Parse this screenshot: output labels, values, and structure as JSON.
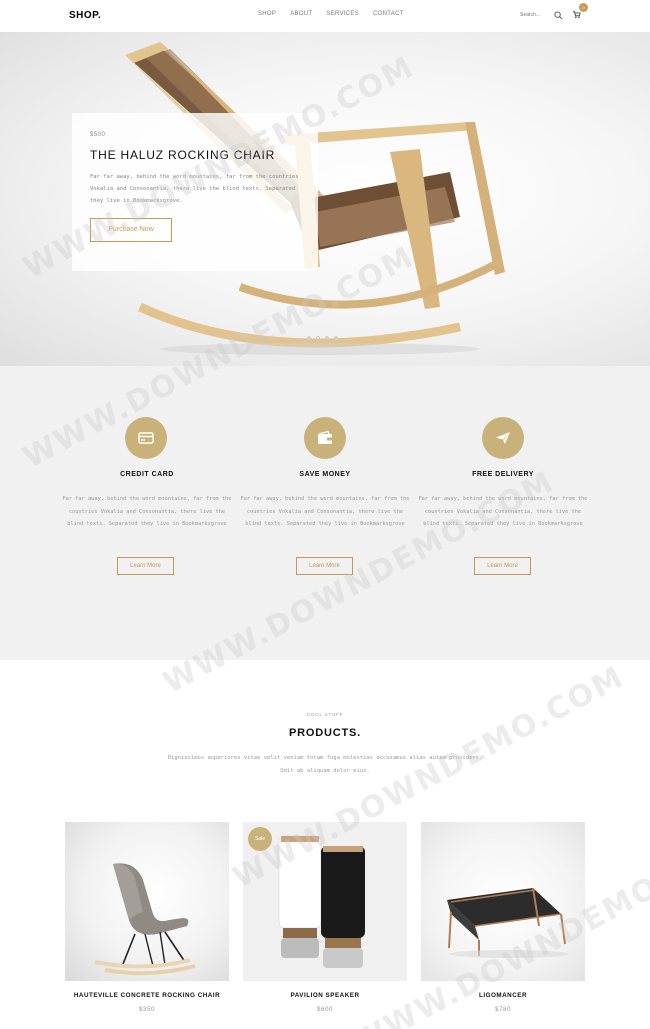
{
  "nav": {
    "logo": "SHOP.",
    "items": [
      {
        "label": "SHOP"
      },
      {
        "label": "ABOUT"
      },
      {
        "label": "SERVICES"
      },
      {
        "label": "CONTACT"
      }
    ],
    "search_placeholder": "Search...",
    "cart_count": "0"
  },
  "hero": {
    "price": "$500",
    "title": "THE HALUZ ROCKING CHAIR",
    "description": "Far far away, behind the word mountains, far from the countries Vokalia and Consonantia, there live the blind texts. Separated they live in Bookmarksgrove.",
    "button_label": "Purchase Now",
    "slides": 4,
    "active_slide": 2
  },
  "features": [
    {
      "icon": "credit-card-icon",
      "title": "CREDIT CARD",
      "description": "Far far away, behind the word mountains, far from the countries Vokalia and Consonantia, there live the blind texts. Separated they live in Bookmarksgrove",
      "button_label": "Learn More"
    },
    {
      "icon": "wallet-icon",
      "title": "SAVE MONEY",
      "description": "Far far away, behind the word mountains, far from the countries Vokalia and Consonantia, there live the blind texts. Separated they live in Bookmarksgrove",
      "button_label": "Learn More"
    },
    {
      "icon": "paper-plane-icon",
      "title": "FREE DELIVERY",
      "description": "Far far away, behind the word mountains, far from the countries Vokalia and Consonantia, there live the blind texts. Separated they live in Bookmarksgrove",
      "button_label": "Learn More"
    }
  ],
  "products_section": {
    "subtitle": "COOL STUFF",
    "title": "PRODUCTS.",
    "description": "Dignissimos asperiores vitae velit veniam totam fuga molestias accusamus alias autem provident. Odit ab aliquam dolor eius."
  },
  "products": [
    {
      "name": "HAUTEVILLE CONCRETE ROCKING CHAIR",
      "price": "$350",
      "sale": ""
    },
    {
      "name": "PAVILION SPEAKER",
      "price": "$600",
      "sale": "Sale"
    },
    {
      "name": "LIGOMANCER",
      "price": "$780",
      "sale": ""
    }
  ],
  "watermark": "WWW.DOWNDEMO.COM",
  "colors": {
    "accent": "#c49a56",
    "icon_circle": "#c9b27a",
    "feature_bg": "#f1f1f1"
  }
}
